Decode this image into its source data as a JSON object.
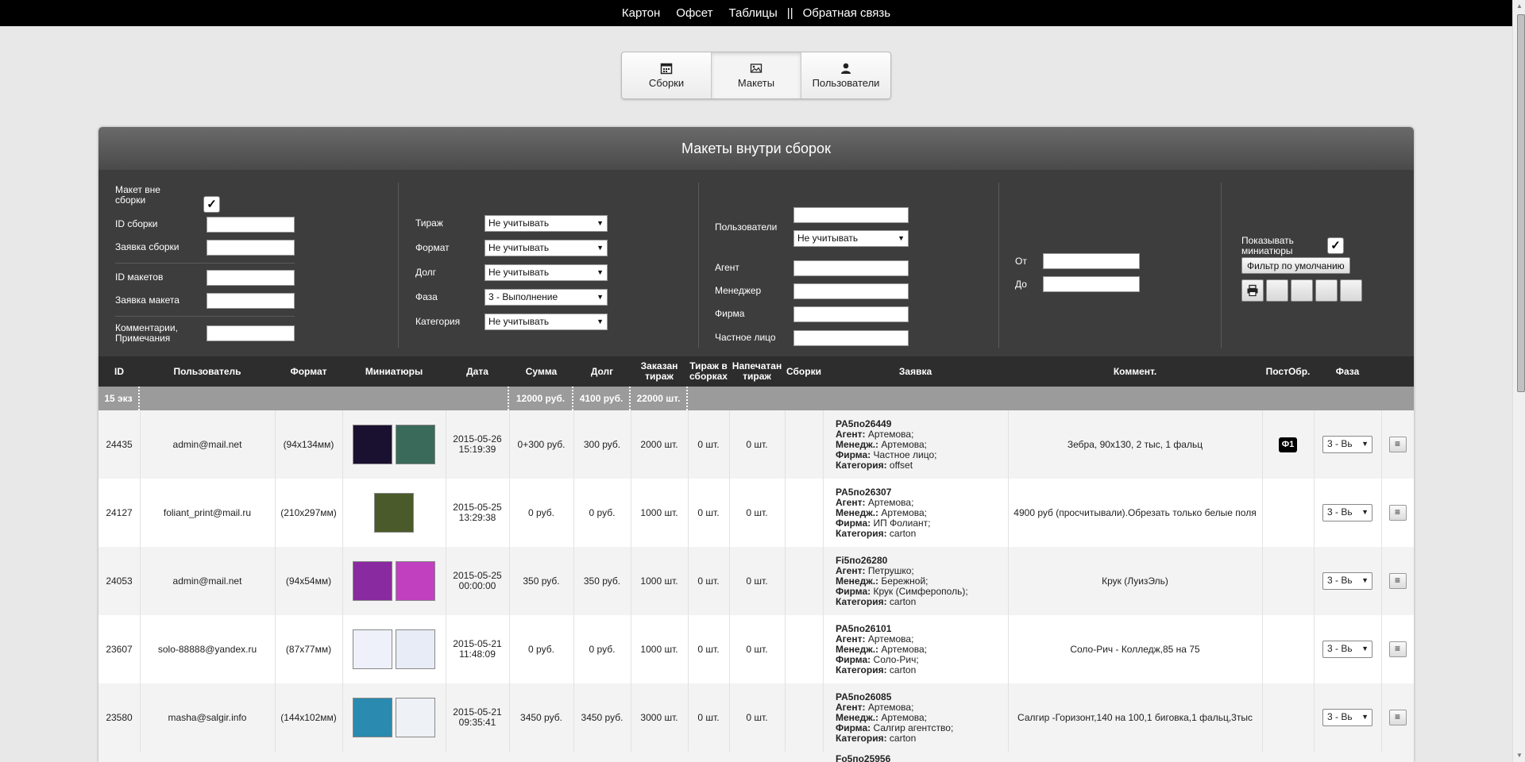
{
  "topnav": {
    "items": [
      "Картон",
      "Офсет",
      "Таблицы"
    ],
    "separator": "||",
    "feedback": "Обратная связь"
  },
  "tabs": [
    {
      "label": "Сборки",
      "icon": "calendar-icon"
    },
    {
      "label": "Макеты",
      "icon": "image-icon",
      "active": true
    },
    {
      "label": "Пользователи",
      "icon": "user-icon"
    }
  ],
  "panel_title": "Макеты внутри сборок",
  "filters": {
    "col1": {
      "outside_label": "Макет вне сборки",
      "outside_checked": true,
      "build_id": "ID сборки",
      "build_request": "Заявка сборки",
      "layout_ids": "ID макетов",
      "layout_request": "Заявка макета",
      "comments": "Комментарии, Примечания"
    },
    "col2": {
      "run_label": "Тираж",
      "run_value": "Не учитывать",
      "format_label": "Формат",
      "format_value": "Не учитывать",
      "debt_label": "Долг",
      "debt_value": "Не учитывать",
      "phase_label": "Фаза",
      "phase_value": "3 - Выполнение",
      "category_label": "Категория",
      "category_value": "Не учитывать"
    },
    "col3": {
      "users_label": "Пользователи",
      "users_select": "Не учитывать",
      "agent": "Агент",
      "manager": "Менеджер",
      "firm": "Фирма",
      "private": "Частное лицо"
    },
    "col4": {
      "from": "От",
      "to": "До"
    },
    "col5": {
      "show_thumbs": "Показывать миниатюры",
      "show_thumbs_checked": true,
      "default_filter": "Фильтр по умолчанию"
    }
  },
  "table": {
    "headers": {
      "id": "ID",
      "user": "Пользователь",
      "format": "Формат",
      "thumbs": "Миниатюры",
      "date": "Дата",
      "sum": "Сумма",
      "debt": "Долг",
      "ordered": "Заказан тираж",
      "run_in_builds": "Тираж в сборках",
      "printed": "Напечатан тираж",
      "builds": "Сборки",
      "request": "Заявка",
      "comment": "Коммент.",
      "post": "ПостОбр.",
      "phase": "Фаза"
    },
    "summary": {
      "count": "15 экз",
      "sum": "12000 руб.",
      "debt": "4100 руб.",
      "ordered": "22000 шт."
    },
    "rows": [
      {
        "id": "24435",
        "user": "admin@mail.net",
        "format": "(94x134мм)",
        "date": "2015-05-26",
        "time": "15:19:39",
        "sum": "0+300 руб.",
        "debt": "300 руб.",
        "ordered": "2000 шт.",
        "in_builds": "0 шт.",
        "printed": "0 шт.",
        "request": "PA5по26449",
        "agent": "Артемова;",
        "manager": "Артемова;",
        "firm": "Частное лицо;",
        "category": "offset",
        "comment": "Зебра, 90x130, 2 тыс, 1 фальц",
        "post": "Ф1",
        "phase": "3 - Вь",
        "thumb_count": 2,
        "thumb_colors": [
          "#1a1030",
          "#3a6a5a"
        ]
      },
      {
        "id": "24127",
        "user": "foliant_print@mail.ru",
        "format": "(210x297мм)",
        "date": "2015-05-25",
        "time": "13:29:38",
        "sum": "0 руб.",
        "debt": "0 руб.",
        "ordered": "1000 шт.",
        "in_builds": "0 шт.",
        "printed": "0 шт.",
        "request": "PA5по26307",
        "agent": "Артемова;",
        "manager": "Артемова;",
        "firm": "ИП Фолиант;",
        "category": "carton",
        "comment": "4900 руб (просчитывали).Обрезать только белые поля",
        "post": "",
        "phase": "3 - Вь",
        "thumb_count": 1,
        "thumb_colors": [
          "#4a5a2a"
        ]
      },
      {
        "id": "24053",
        "user": "admin@mail.net",
        "format": "(94x54мм)",
        "date": "2015-05-25",
        "time": "00:00:00",
        "sum": "350 руб.",
        "debt": "350 руб.",
        "ordered": "1000 шт.",
        "in_builds": "0 шт.",
        "printed": "0 шт.",
        "request": "Fi5по26280",
        "agent": "Петрушко;",
        "manager": "Бережной;",
        "firm": "Крук (Симферополь);",
        "category": "carton",
        "comment": "Крук (ЛуизЭль)",
        "post": "",
        "phase": "3 - Вь",
        "thumb_count": 2,
        "thumb_colors": [
          "#8a2aa0",
          "#c040c0"
        ]
      },
      {
        "id": "23607",
        "user": "solo-88888@yandex.ru",
        "format": "(87x77мм)",
        "date": "2015-05-21",
        "time": "11:48:09",
        "sum": "0 руб.",
        "debt": "0 руб.",
        "ordered": "1000 шт.",
        "in_builds": "0 шт.",
        "printed": "0 шт.",
        "request": "PA5по26101",
        "agent": "Артемова;",
        "manager": "Артемова;",
        "firm": "Соло-Рич;",
        "category": "carton",
        "comment": "Соло-Рич - Колледж,85 на 75",
        "post": "",
        "phase": "3 - Вь",
        "thumb_count": 2,
        "thumb_colors": [
          "#eef0fa",
          "#e8ecf6"
        ]
      },
      {
        "id": "23580",
        "user": "masha@salgir.info",
        "format": "(144x102мм)",
        "date": "2015-05-21",
        "time": "09:35:41",
        "sum": "3450 руб.",
        "debt": "3450 руб.",
        "ordered": "3000 шт.",
        "in_builds": "0 шт.",
        "printed": "0 шт.",
        "request": "PA5по26085",
        "agent": "Артемова;",
        "manager": "Артемова;",
        "firm": "Салгир агентство;",
        "category": "carton",
        "comment": "Салгир -Горизонт,140 на 100,1 биговка,1 фальц,3тыс",
        "post": "",
        "phase": "3 - Вь",
        "thumb_count": 2,
        "thumb_colors": [
          "#2a8ab0",
          "#eef2f6"
        ]
      }
    ],
    "partial_row_request": "Fo5по25956"
  },
  "labels": {
    "agent": "Агент:",
    "manager": "Менедж.:",
    "firm": "Фирма:",
    "category": "Категория:"
  }
}
